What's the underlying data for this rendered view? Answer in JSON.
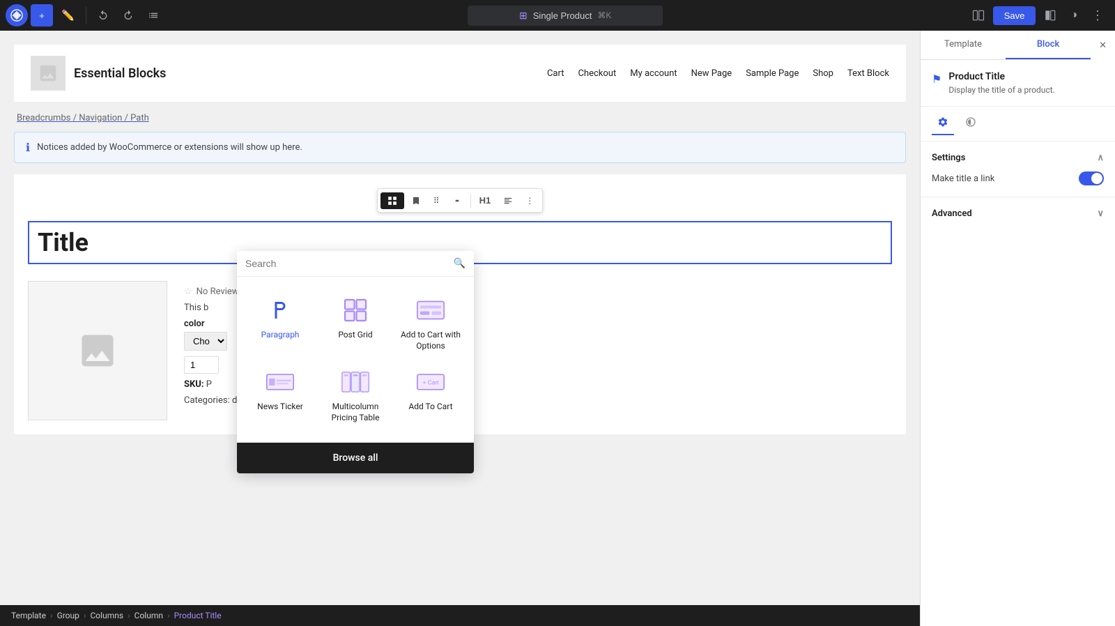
{
  "topToolbar": {
    "addLabel": "+",
    "editLabel": "✏",
    "undoLabel": "↩",
    "redoLabel": "↪",
    "listViewLabel": "☰",
    "pageTitle": "Single Product",
    "shortcut": "⌘K",
    "saveLabel": "Save",
    "viewIcon": "□",
    "settingsIcon": "⚙",
    "moreIcon": "⋮"
  },
  "siteHeader": {
    "logoAlt": "Essential Blocks Logo",
    "siteName": "Essential Blocks",
    "nav": [
      {
        "label": "Cart"
      },
      {
        "label": "Checkout"
      },
      {
        "label": "My account"
      },
      {
        "label": "New Page"
      },
      {
        "label": "Sample Page"
      },
      {
        "label": "Shop"
      },
      {
        "label": "Text Block"
      }
    ]
  },
  "breadcrumbs": {
    "text": "Breadcrumbs / Navigation / Path"
  },
  "noticebar": {
    "text": "Notices added by WooCommerce or extensions will show up here."
  },
  "product": {
    "title": "Title",
    "reviewsText": "No Reviews",
    "descText": "This b",
    "colorLabel": "color",
    "colorPlaceholder": "Cho",
    "quantity": "1",
    "skuLabel": "SKU:",
    "skuValue": "P",
    "categoriesLabel": "Categories:",
    "categoriesValue": "duct"
  },
  "blockToolbar": {
    "changeTypeLabel": "¶",
    "dragLabel": "⠿",
    "moveLabel": "↕",
    "h1Label": "H1",
    "alignLabel": "≡",
    "moreLabel": "⋮"
  },
  "inserter": {
    "searchPlaceholder": "Search",
    "items": [
      {
        "id": "paragraph",
        "label": "Paragraph",
        "type": "paragraph",
        "active": true
      },
      {
        "id": "post-grid",
        "label": "Post Grid",
        "type": "post-grid",
        "active": false
      },
      {
        "id": "add-to-cart-options",
        "label": "Add to Cart with Options",
        "type": "add-to-cart-options",
        "active": false
      },
      {
        "id": "news-ticker",
        "label": "News Ticker",
        "type": "news-ticker",
        "active": false
      },
      {
        "id": "multicolumn-pricing",
        "label": "Multicolumn Pricing Table",
        "type": "multicolumn-pricing",
        "active": false
      },
      {
        "id": "add-to-cart",
        "label": "Add To Cart",
        "type": "add-to-cart",
        "active": false
      }
    ],
    "browseAllLabel": "Browse all"
  },
  "sidebar": {
    "templateTabLabel": "Template",
    "blockTabLabel": "Block",
    "closeIcon": "✕",
    "product": {
      "icon": "⚑",
      "name": "Product Title",
      "description": "Display the title of a product."
    },
    "settingsIcon": "⚙",
    "halfCircleIcon": "◐",
    "settings": {
      "sectionLabel": "Settings",
      "toggleLabel": "Make title a link",
      "toggleOn": true
    },
    "advanced": {
      "sectionLabel": "Advanced"
    }
  },
  "bottomBreadcrumb": {
    "items": [
      {
        "label": "Template",
        "isCurrent": false
      },
      {
        "label": "Group",
        "isCurrent": false
      },
      {
        "label": "Columns",
        "isCurrent": false
      },
      {
        "label": "Column",
        "isCurrent": false
      },
      {
        "label": "Product Title",
        "isCurrent": true
      }
    ]
  }
}
